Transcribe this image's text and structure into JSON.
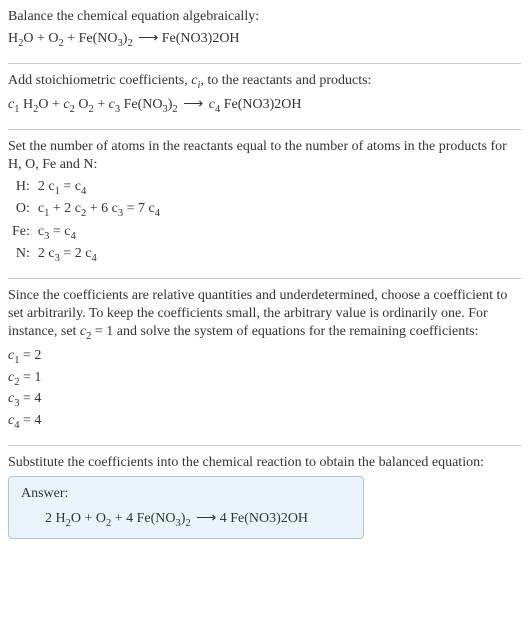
{
  "section1": {
    "title": "Balance the chemical equation algebraically:",
    "eq_h2o": "H",
    "eq_h2o_sub": "2",
    "eq_o": "O + O",
    "eq_o2_sub": "2",
    "eq_plus_fe": " + Fe(NO",
    "eq_no3_sub": "3",
    "eq_close": ")",
    "eq_close_sub": "2",
    "eq_arrow": " ⟶ Fe(NO3)2OH"
  },
  "section2": {
    "title_pre": "Add stoichiometric coefficients, ",
    "title_ci": "c",
    "title_ci_sub": "i",
    "title_post": ", to the reactants and products:",
    "c1": "c",
    "c1sub": "1",
    "sp1": " H",
    "h2sub": "2",
    "o_plus": "O + ",
    "c2": "c",
    "c2sub": "2",
    "sp2": " O",
    "o2sub": "2",
    "plus": " + ",
    "c3": "c",
    "c3sub": "3",
    "sp3": " Fe(NO",
    "no3sub": "3",
    "close": ")",
    "closesub": "2",
    "arrow": " ⟶ ",
    "c4": "c",
    "c4sub": "4",
    "prod": " Fe(NO3)2OH"
  },
  "section3": {
    "intro": "Set the number of atoms in the reactants equal to the number of atoms in the products for H, O, Fe and N:",
    "rows": [
      {
        "label": "H:",
        "lhs_a": "2 c",
        "lhs_a_sub": "1",
        "eq": " = ",
        "rhs_a": "c",
        "rhs_a_sub": "4"
      },
      {
        "label": "O:",
        "full": true
      },
      {
        "label": "Fe:",
        "lhs_a": "c",
        "lhs_a_sub": "3",
        "eq": " = ",
        "rhs_a": "c",
        "rhs_a_sub": "4"
      },
      {
        "label": "N:",
        "lhs_a": "2 c",
        "lhs_a_sub": "3",
        "eq": " = 2 ",
        "rhs_a": "c",
        "rhs_a_sub": "4"
      }
    ],
    "o_row": {
      "p1": "c",
      "s1": "1",
      "p2": " + 2 c",
      "s2": "2",
      "p3": " + 6 c",
      "s3": "3",
      "eq": " = 7 c",
      "s4": "4"
    }
  },
  "section4": {
    "text_pre": "Since the coefficients are relative quantities and underdetermined, choose a coefficient to set arbitrarily. To keep the coefficients small, the arbitrary value is ordinarily one. For instance, set ",
    "c2": "c",
    "c2sub": "2",
    "text_post": " = 1 and solve the system of equations for the remaining coefficients:",
    "coefs": [
      {
        "c": "c",
        "sub": "1",
        "val": " = 2"
      },
      {
        "c": "c",
        "sub": "2",
        "val": " = 1"
      },
      {
        "c": "c",
        "sub": "3",
        "val": " = 4"
      },
      {
        "c": "c",
        "sub": "4",
        "val": " = 4"
      }
    ]
  },
  "section5": {
    "text": "Substitute the coefficients into the chemical reaction to obtain the balanced equation:",
    "answer_label": "Answer:",
    "eq_pre": "2 H",
    "h2sub": "2",
    "o_o2": "O + O",
    "o2sub": "2",
    "plus4fe": " + 4 Fe(NO",
    "no3sub": "3",
    "close": ")",
    "closesub": "2",
    "arrow": " ⟶ 4 Fe(NO3)2OH"
  }
}
